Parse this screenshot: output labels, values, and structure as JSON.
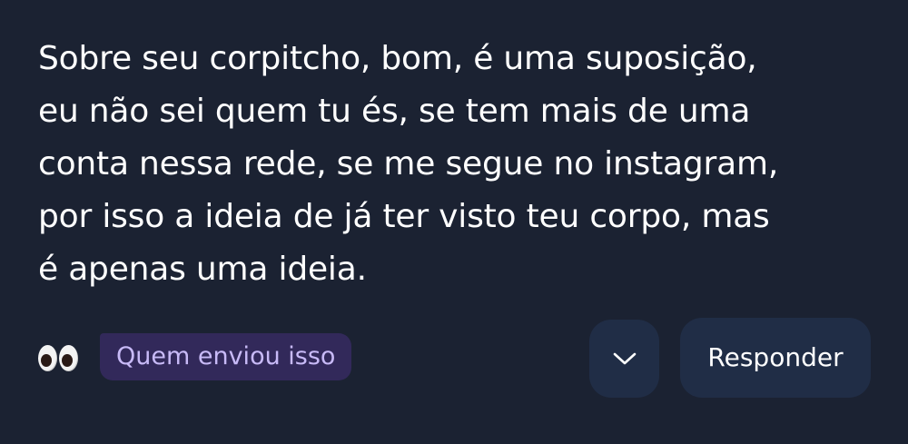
{
  "message": {
    "lines": [
      "Sobre seu corpitcho, bom, é uma suposição,",
      "eu não sei quem tu és, se tem mais de uma",
      "conta nessa rede, se me segue no instagram,",
      "por isso a ideia de já ter visto teu corpo, mas",
      "é apenas uma ideia."
    ]
  },
  "footer": {
    "reaction_icon": "eyes-emoji",
    "sender_chip_label": "Quem enviou isso",
    "expand_icon": "chevron-down-icon",
    "reply_label": "Responder"
  },
  "colors": {
    "background": "#1b2232",
    "text": "#ffffff",
    "chip_background": "#32295a",
    "chip_text": "#c8baf7",
    "button_background": "#202d46"
  }
}
